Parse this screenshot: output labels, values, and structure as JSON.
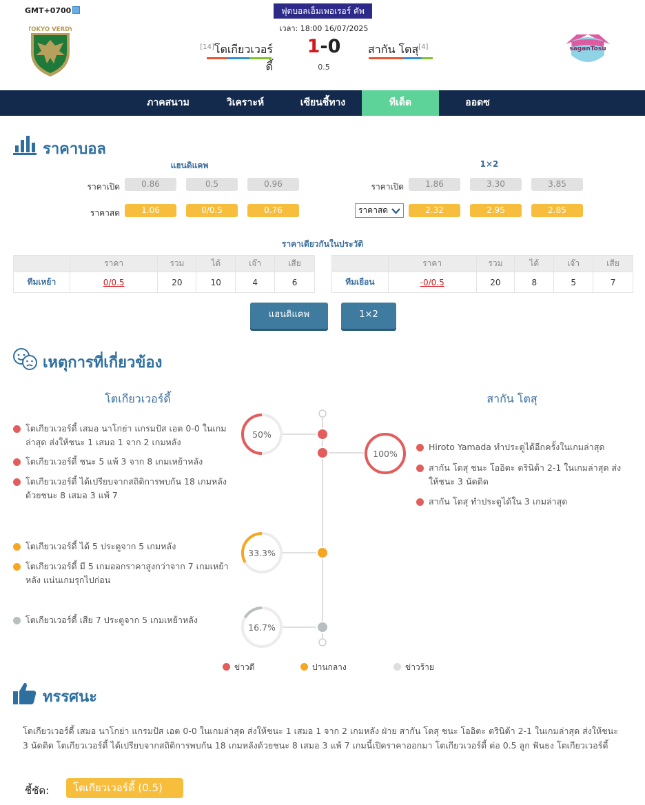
{
  "header": {
    "timezone": "GMT+0700",
    "league": "ฟุตบอลเอ็มเพอเรอร์ คัพ",
    "kickoff": "เวลา: 18:00 16/07/2025",
    "home": {
      "name": "โตเกียวเวอร์ดี้",
      "rank": "[14]",
      "score": "1",
      "logo_text": "TOKYO VERDY"
    },
    "away": {
      "name": "สากัน โตสุ",
      "rank": "[4]",
      "score": "0",
      "logo_text": "saganTosu"
    },
    "separator": "-",
    "handicap": "0.5"
  },
  "nav": {
    "tabs": [
      "ภาคสนาม",
      "วิเคราะห์",
      "เซียนชี้ทาง",
      "ทีเด็ด",
      "ออดซ"
    ],
    "active": "ทีเด็ด"
  },
  "odds": {
    "title": "ราคาบอล",
    "handicap": {
      "header": "แฮนดิแคพ",
      "open_label": "ราคาเปิด",
      "live_label": "ราคาสด",
      "open": [
        "0.86",
        "0.5",
        "0.96"
      ],
      "live": [
        "1.06",
        "0/0.5",
        "0.76"
      ]
    },
    "onextwo": {
      "header": "1×2",
      "open_label": "ราคาเปิด",
      "live_select": "ราคาสด",
      "open": [
        "1.86",
        "3.30",
        "3.85"
      ],
      "live": [
        "2.32",
        "2.95",
        "2.85"
      ]
    },
    "history": {
      "title": "ราคาเดียวกันในประวัติ",
      "columns": [
        "ราคา",
        "รวม",
        "ได้",
        "เจ๊า",
        "เสีย"
      ],
      "rows": [
        {
          "team": "ทีมเหย้า",
          "price": "0/0.5",
          "total": "20",
          "win": "10",
          "draw": "4",
          "lose": "6"
        },
        {
          "team": "ทีมเยือน",
          "price": "-0/0.5",
          "total": "20",
          "win": "8",
          "draw": "5",
          "lose": "7"
        }
      ]
    },
    "buttons": [
      "แฮนดิแคพ",
      "1×2"
    ]
  },
  "events": {
    "title": "เหตุการที่เกี่ยวข้อง",
    "home_team": "โตเกียวเวอร์ดี้",
    "away_team": "สากัน โตสุ",
    "home_good": [
      "โตเกียวเวอร์ดี้ เสมอ นาโกย่า แกรมปัส เอต 0-0 ในเกมล่าสุด ส่งให้ชนะ 1 เสมอ 1 จาก 2 เกมหลัง",
      "โตเกียวเวอร์ดี้ ชนะ 5 แพ้ 3 จาก 8 เกมเหย้าหลัง",
      "โตเกียวเวอร์ดี้ ได้เปรียบจากสถิติการพบกัน 18 เกมหลังด้วยชนะ 8 เสมอ 3 แพ้ 7"
    ],
    "home_neutral": [
      "โตเกียวเวอร์ดี้ ได้ 5 ประตูจาก 5 เกมหลัง",
      "โตเกียวเวอร์ดี้ มี 5 เกมออกราคาสูงกว่าจาก 7 เกมเหย้าหลัง แน่นเกมรุกไปก่อน"
    ],
    "home_bad": [
      "โตเกียวเวอร์ดี้ เสีย 7 ประตูจาก 5 เกมเหย้าหลัง"
    ],
    "away_good": [
      "Hiroto Yamada ทำประตูได้อีกครั้งในเกมล่าสุด",
      "สากัน โตสุ ชนะ โออิตะ ตรินิต้า 2-1 ในเกมล่าสุด ส่งให้ชนะ 3 นัดติด",
      "สากัน โตสุ ทำประตูได้ใน 3 เกมล่าสุด"
    ],
    "home_good_pct": "50%",
    "home_neutral_pct": "33.3%",
    "home_bad_pct": "16.7%",
    "away_good_pct": "100%",
    "legend": [
      "ข่าวดี",
      "ปานกลาง",
      "ข่าวร้าย"
    ],
    "colors": {
      "good": "#e35d5d",
      "neutral": "#f5a623",
      "bad": "#b8c0bf"
    }
  },
  "verdict": {
    "title": "ทรรศนะ",
    "text": "โตเกียวเวอร์ดี้ เสมอ นาโกย่า แกรมปัส เอต 0-0 ในเกมล่าสุด ส่งให้ชนะ 1 เสมอ 1 จาก 2 เกมหลัง ฝ่าย สากัน โตสุ ชนะ โออิตะ ตรินิต้า 2-1 ในเกมล่าสุด ส่งให้ชนะ 3 นัดติด โตเกียวเวอร์ดี้ ได้เปรียบจากสถิติการพบกัน 18 เกมหลังด้วยชนะ 8 เสมอ 3 แพ้ 7 เกมนี้เปิดราคาออกมา โตเกียวเวอร์ดี้ ต่อ 0.5 ลูก ฟันธง โตเกียวเวอร์ดี้",
    "tip_label": "ชี้ชัด:",
    "tip_value": "โตเกียวเวอร์ดี้ (0.5)"
  }
}
